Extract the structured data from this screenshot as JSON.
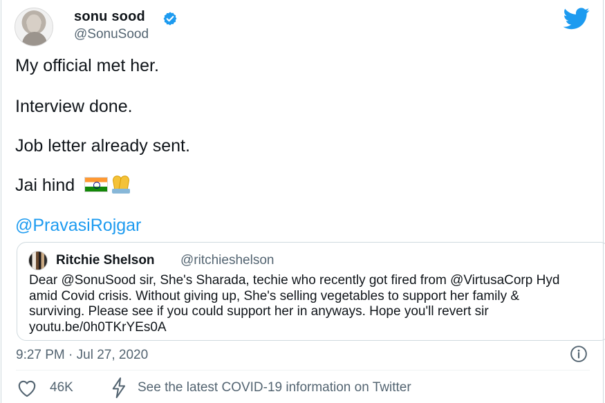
{
  "author": {
    "name": "sonu sood",
    "handle": "@SonuSood"
  },
  "tweet": {
    "line1": "My official met her.",
    "line2": "Interview done.",
    "line3": "Job letter already sent.",
    "line4": "Jai hind",
    "mention": "@PravasiRojgar"
  },
  "quoted": {
    "name": "Ritchie Shelson",
    "handle": "@ritchieshelson",
    "text": "Dear @SonuSood sir, She's Sharada, techie who recently got fired from @VirtusaCorp Hyd amid Covid crisis. Without giving up, She's selling vegetables to support her family & surviving. Please see if you could support her in anyways. Hope you'll revert sir youtu.be/0h0TKrYEs0A"
  },
  "meta": {
    "timestamp": "9:27 PM · Jul 27, 2020",
    "likes": "46K",
    "covid_link": "See the latest COVID-19 information on Twitter"
  },
  "colors": {
    "link": "#1d9bf0",
    "secondary_text": "#536471",
    "border": "#cfd9de",
    "verified": "#1d9bf0",
    "flag_saffron": "#ff9933",
    "flag_green": "#138808",
    "flag_chakra": "#000080"
  },
  "icons": {
    "verified": "verified-badge-icon",
    "brand": "twitter-bird-icon",
    "emoji_flag": "india-flag-emoji",
    "emoji_hands": "folded-hands-emoji",
    "info": "info-icon",
    "like": "heart-icon",
    "covid": "lightning-bolt-icon"
  }
}
